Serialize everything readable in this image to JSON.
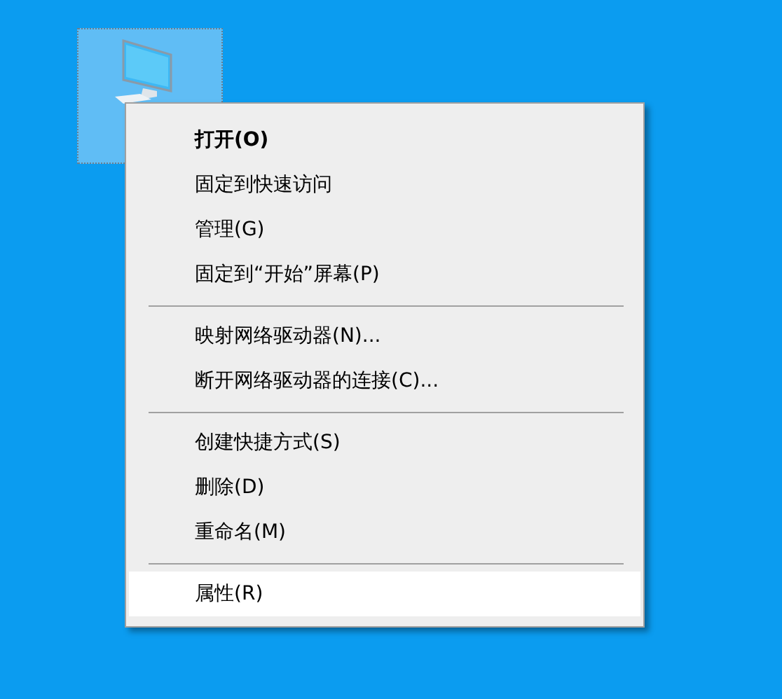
{
  "desktop_icon": {
    "selected": true
  },
  "context_menu": {
    "items": [
      {
        "kind": "item",
        "label": "打开(O)",
        "default": true,
        "selected": false
      },
      {
        "kind": "item",
        "label": "固定到快速访问",
        "default": false,
        "selected": false
      },
      {
        "kind": "item",
        "label": "管理(G)",
        "default": false,
        "selected": false
      },
      {
        "kind": "item",
        "label": "固定到“开始”屏幕(P)",
        "default": false,
        "selected": false
      },
      {
        "kind": "separator"
      },
      {
        "kind": "item",
        "label": "映射网络驱动器(N)...",
        "default": false,
        "selected": false
      },
      {
        "kind": "item",
        "label": "断开网络驱动器的连接(C)...",
        "default": false,
        "selected": false
      },
      {
        "kind": "separator"
      },
      {
        "kind": "item",
        "label": "创建快捷方式(S)",
        "default": false,
        "selected": false
      },
      {
        "kind": "item",
        "label": "删除(D)",
        "default": false,
        "selected": false
      },
      {
        "kind": "item",
        "label": "重命名(M)",
        "default": false,
        "selected": false
      },
      {
        "kind": "separator"
      },
      {
        "kind": "item",
        "label": "属性(R)",
        "default": false,
        "selected": true
      }
    ]
  }
}
